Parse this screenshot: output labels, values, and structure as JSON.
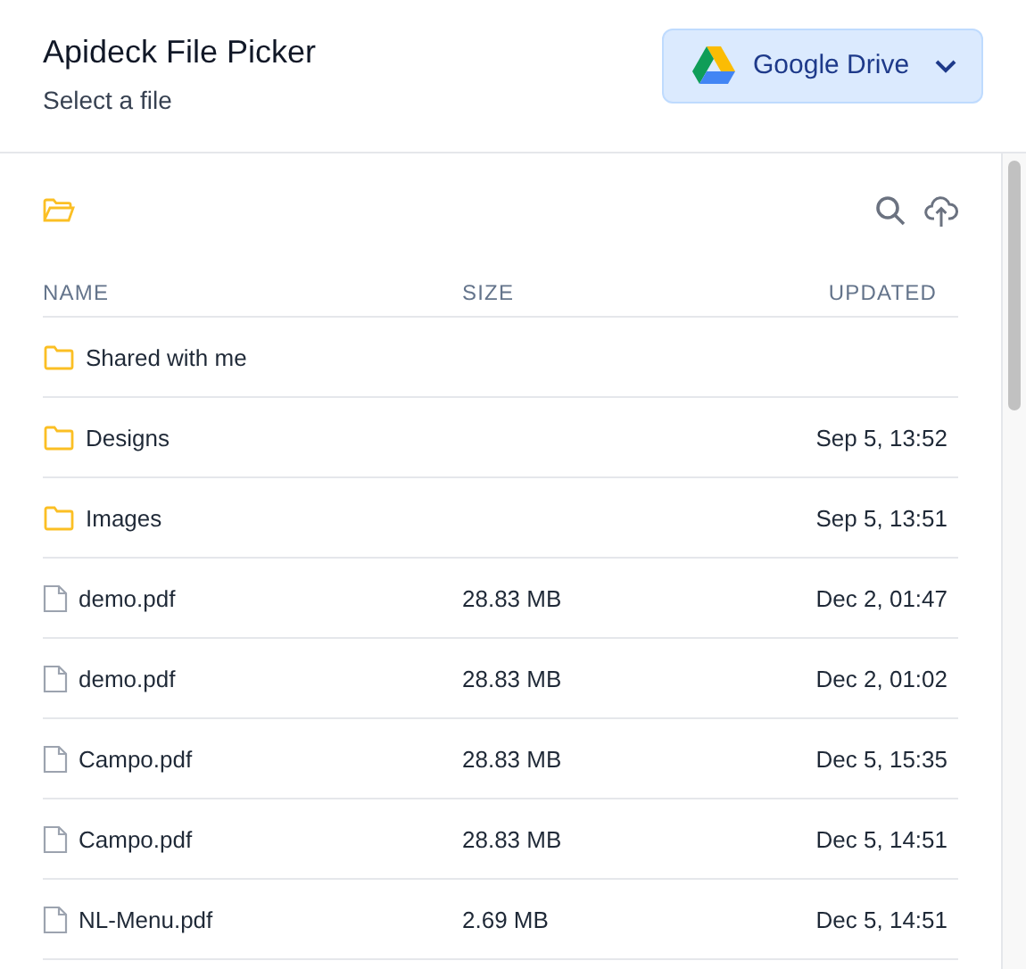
{
  "header": {
    "title": "Apideck File Picker",
    "subtitle": "Select a file"
  },
  "provider": {
    "label": "Google Drive"
  },
  "table": {
    "columns": [
      "NAME",
      "SIZE",
      "UPDATED"
    ],
    "rows": [
      {
        "kind": "folder",
        "name": "Shared with me"
      },
      {
        "kind": "folder",
        "name": "Designs",
        "updated": "Sep 5, 13:52"
      },
      {
        "kind": "folder",
        "name": "Images",
        "updated": "Sep 5, 13:51"
      },
      {
        "kind": "file",
        "name": "demo.pdf",
        "size": "28.83 MB",
        "updated": "Dec 2, 01:47"
      },
      {
        "kind": "file",
        "name": "demo.pdf",
        "size": "28.83 MB",
        "updated": "Dec 2, 01:02"
      },
      {
        "kind": "file",
        "name": "Campo.pdf",
        "size": "28.83 MB",
        "updated": "Dec 5, 15:35"
      },
      {
        "kind": "file",
        "name": "Campo.pdf",
        "size": "28.83 MB",
        "updated": "Dec 5, 14:51"
      },
      {
        "kind": "file",
        "name": "NL-Menu.pdf",
        "size": "2.69 MB",
        "updated": "Dec 5, 14:51"
      }
    ]
  }
}
